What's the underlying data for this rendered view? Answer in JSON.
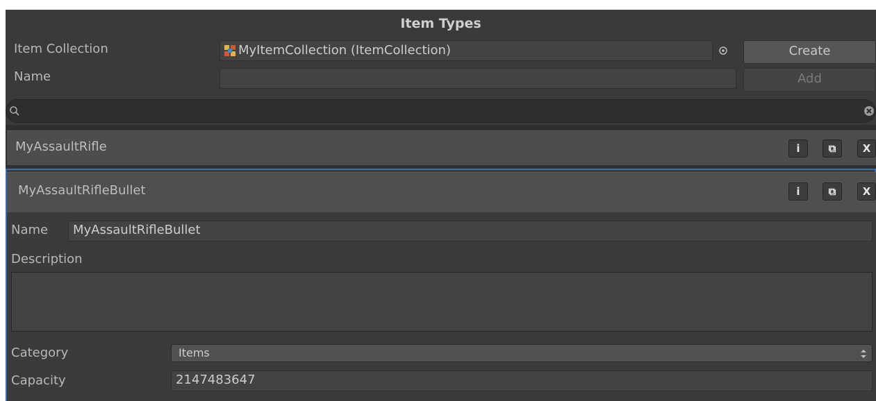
{
  "window": {
    "title": "Item Types"
  },
  "top": {
    "collection_label": "Item Collection",
    "collection_value": "MyItemCollection (ItemCollection)",
    "name_label": "Name",
    "name_value": "",
    "create_label": "Create",
    "add_label": "Add"
  },
  "search": {
    "value": ""
  },
  "items": [
    {
      "label": "MyAssaultRifle",
      "selected": false
    },
    {
      "label": "MyAssaultRifleBullet",
      "selected": true
    }
  ],
  "row_buttons": {
    "info_glyph": "i",
    "duplicate_glyph": "⧉",
    "remove_glyph": "X"
  },
  "details": {
    "name_label": "Name",
    "name_value": "MyAssaultRifleBullet",
    "description_label": "Description",
    "description_value": "",
    "category_label": "Category",
    "category_value": "Items",
    "capacity_label": "Capacity",
    "capacity_value": "2147483647"
  },
  "colors": {
    "panel": "#3a3a3a",
    "row": "#4d4d4d",
    "selection_border": "#3d6aa8"
  }
}
